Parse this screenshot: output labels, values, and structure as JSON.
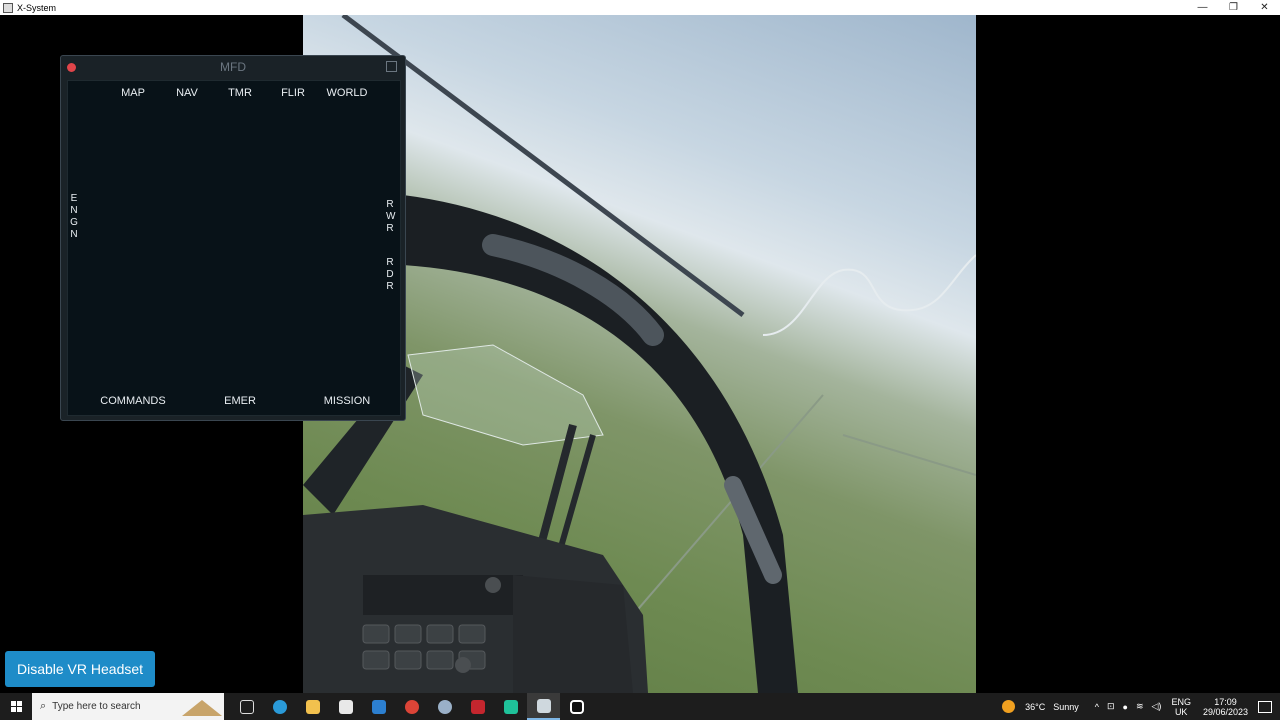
{
  "window": {
    "title": "X-System",
    "minimize": "—",
    "maximize": "❐",
    "close": "✕"
  },
  "mfd": {
    "title": "MFD",
    "top_buttons": [
      "MAP",
      "NAV",
      "TMR",
      "FLIR",
      "WORLD"
    ],
    "left_label": "ENGN",
    "right_labels": [
      "RWR",
      "RDR"
    ],
    "bottom_buttons": [
      "COMMANDS",
      "EMER",
      "MISSION"
    ]
  },
  "vr_button": {
    "label": "Disable VR Headset"
  },
  "taskbar": {
    "search_placeholder": "Type here to search",
    "apps": [
      "task-view",
      "edge",
      "file-explorer",
      "store",
      "mail",
      "chrome",
      "app-1",
      "app-2",
      "app-3",
      "x-plane",
      "app-4"
    ],
    "weather": {
      "temp": "36°C",
      "condition": "Sunny"
    },
    "language": {
      "top": "ENG",
      "bottom": "UK"
    },
    "clock": {
      "time": "17:09",
      "date": "29/06/2023"
    }
  }
}
